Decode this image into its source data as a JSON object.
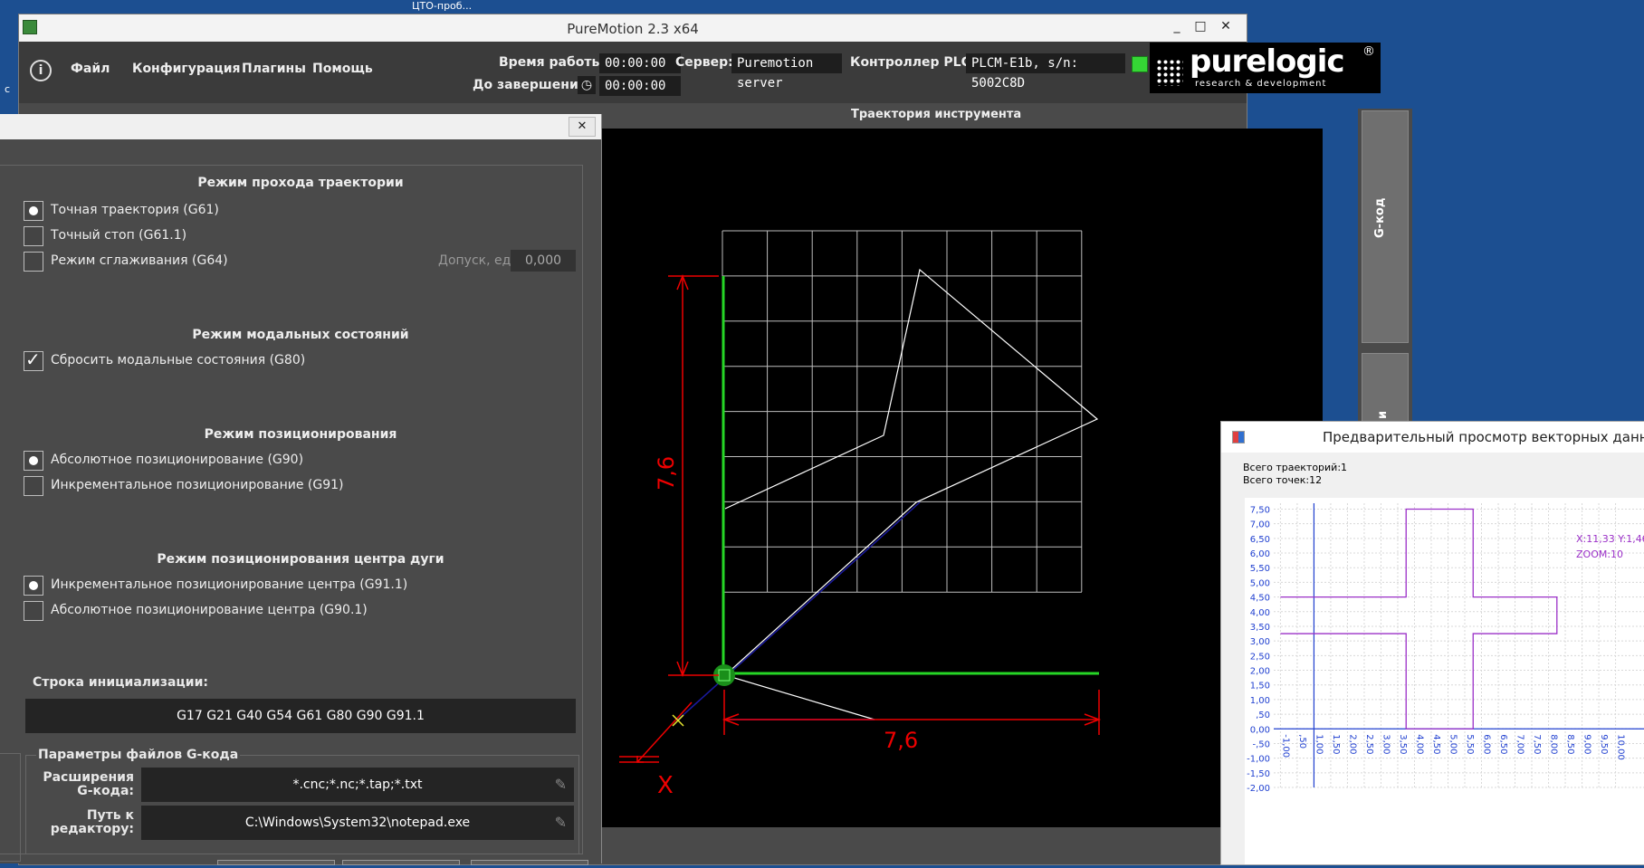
{
  "desktop": {
    "taskbar_title": "ЦТО-проб..."
  },
  "app": {
    "title": "PureMotion 2.3 x64",
    "menu": [
      "Файл",
      "Конфигурация",
      "Плагины",
      "Помощь"
    ],
    "status": {
      "uptime_label": "Время работы:",
      "uptime_value": "00:00:00",
      "remaining_label": "До завершения:",
      "remaining_value": "00:00:00",
      "server_label": "Сервер:",
      "server_value": "Puremotion server",
      "plc_label": "Контроллер PLCM:",
      "plc_value": "PLCM-E1b, s/n: 5002C8D",
      "plc_status_color": "#35d635"
    },
    "logo": {
      "word": "purelogic",
      "sub": "research & development",
      "reg": "®"
    },
    "window_buttons": {
      "minimize": "_",
      "maximize": "□",
      "close": "✕"
    }
  },
  "trajectory": {
    "title": "Траектория инструмента",
    "dim_vertical": "7,6",
    "dim_horizontal": "7,6",
    "axis_x_label": "X",
    "side_tab": "G-код",
    "side_tab2": "и"
  },
  "dialog": {
    "close": "✕",
    "path_mode": {
      "title": "Режим прохода траектории",
      "options": [
        {
          "label": "Точная траектория (G61)",
          "state": "selected"
        },
        {
          "label": "Точный стоп (G61.1)",
          "state": "off"
        },
        {
          "label": "Режим сглаживания (G64)",
          "state": "off"
        }
      ],
      "tolerance_label": "Допуск, ед",
      "tolerance_value": "0,000"
    },
    "modal": {
      "title": "Режим модальных состояний",
      "options": [
        {
          "label": "Сбросить модальные состояния (G80)",
          "state": "checked"
        }
      ]
    },
    "positioning": {
      "title": "Режим позиционирования",
      "options": [
        {
          "label": "Абсолютное позиционирование (G90)",
          "state": "selected"
        },
        {
          "label": "Инкрементальное позиционирование (G91)",
          "state": "off"
        }
      ]
    },
    "arc_center": {
      "title": "Режим позиционирования центра дуги",
      "options": [
        {
          "label": "Инкрементальное позиционирование центра (G91.1)",
          "state": "selected"
        },
        {
          "label": "Абсолютное позиционирование центра (G90.1)",
          "state": "off"
        }
      ]
    },
    "init": {
      "label": "Строка инициализации:",
      "value": "G17 G21 G40 G54 G61 G80 G90 G91.1"
    },
    "files": {
      "title": "Параметры файлов G-кода",
      "ext_label": "Расширения G-кода:",
      "ext_value": "*.cnc;*.nc;*.tap;*.txt",
      "editor_label": "Путь к редактору:",
      "editor_value": "C:\\Windows\\System32\\notepad.exe"
    }
  },
  "preview": {
    "title": "Предварительный просмотр векторных данных",
    "total_paths": "Всего траекторий:1",
    "total_points": "Всего точек:12",
    "cursor": "X:11,33 Y:1,46",
    "zoom": "ZOOM:10",
    "y_ticks": [
      "7,50",
      "7,00",
      "6,50",
      "6,00",
      "5,50",
      "5,00",
      "4,50",
      "4,00",
      "3,50",
      "3,00",
      "2,50",
      "2,00",
      "1,50",
      "1,00",
      ",50",
      "0,00",
      "-,50",
      "-1,00",
      "-1,50",
      "-2,00"
    ],
    "x_ticks": [
      "-1,00",
      ",50",
      "1,00",
      "1,50",
      "2,00",
      "2,50",
      "3,00",
      "3,50",
      "4,00",
      "4,50",
      "5,00",
      "5,50",
      "6,00",
      "6,50",
      "7,00",
      "7,50",
      "8,00",
      "8,50",
      "9,00",
      "9,50",
      "10,00"
    ],
    "plot_color": "#9b30c8",
    "axis_color": "#2040d0"
  },
  "chart_data": {
    "type": "line",
    "title": "",
    "xlabel": "",
    "ylabel": "",
    "xlim": [
      -1.2,
      10.2
    ],
    "ylim": [
      -2.0,
      7.7
    ],
    "series": [
      {
        "x": [
          -1.0,
          2.75,
          2.75,
          4.75,
          4.75,
          7.25,
          7.25,
          4.75,
          4.75,
          2.75,
          2.75,
          -1.0
        ],
        "y": [
          4.5,
          4.5,
          7.5,
          7.5,
          4.5,
          4.5,
          3.25,
          3.25,
          0.0,
          0.0,
          3.25,
          3.25
        ]
      }
    ],
    "grid": true
  }
}
